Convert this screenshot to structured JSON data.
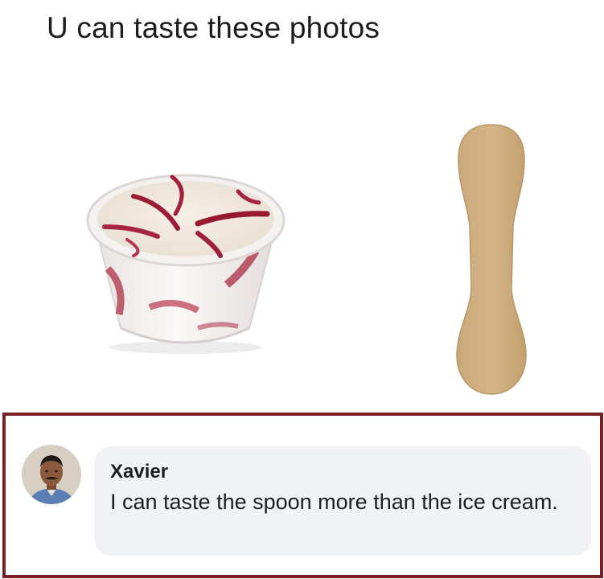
{
  "post": {
    "text": "U can taste these photos"
  },
  "photos": {
    "left_image": "ice-cream-cup-photo",
    "right_image": "wooden-spoon-photo"
  },
  "comment": {
    "avatar_icon": "user-avatar-icon",
    "author": "Xavier",
    "text": "I can taste the spoon more than the ice cream.",
    "frame_color": "#7a1f23",
    "bubble_color": "#f0f2f5"
  }
}
